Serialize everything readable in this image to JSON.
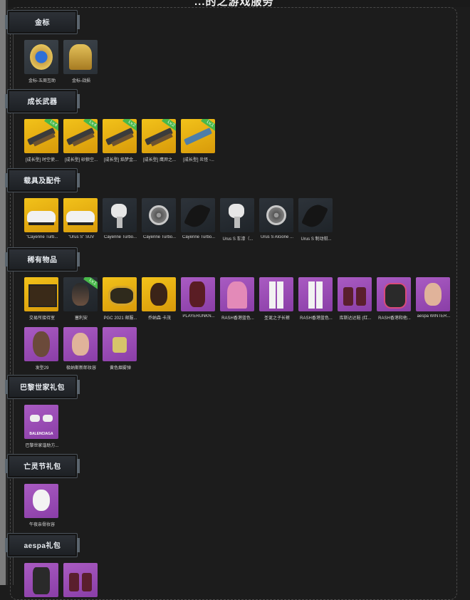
{
  "page": {
    "title": "...的之游戏服务"
  },
  "sections": [
    {
      "id": "gold-badge",
      "title": "金标",
      "items": [
        {
          "label": "金标-五周互助",
          "bg": "gray",
          "icon": "gold-emblem-icon",
          "badge": ""
        },
        {
          "label": "金标-战损",
          "bg": "gray",
          "icon": "gold-soldier-icon",
          "badge": ""
        }
      ]
    },
    {
      "id": "growth-weapons",
      "title": "成长武器",
      "items": [
        {
          "label": "[成长型] 时空使...",
          "bg": "yellow",
          "icon": "rifle-icon",
          "badge": "Lv.4"
        },
        {
          "label": "[成长型] 砂狼空...",
          "bg": "yellow",
          "icon": "rifle-icon",
          "badge": "Lv.4"
        },
        {
          "label": "[成长型] 焰梦金...",
          "bg": "yellow",
          "icon": "rifle-icon",
          "badge": "Lv.2"
        },
        {
          "label": "[成长型] 鹰羿之...",
          "bg": "yellow",
          "icon": "rifle-icon",
          "badge": "Lv.2"
        },
        {
          "label": "[成长型] 炎怪 -...",
          "bg": "yellow",
          "icon": "smg-icon",
          "badge": "Lv.1"
        }
      ]
    },
    {
      "id": "vehicles",
      "title": "载具及配件",
      "items": [
        {
          "label": "\"Cayenne Turb...",
          "bg": "yellow",
          "icon": "car-icon",
          "badge": ""
        },
        {
          "label": "\"Urus S\" SUV",
          "bg": "yellow",
          "icon": "car-icon",
          "badge": ""
        },
        {
          "label": "Cayenne Turbo...",
          "bg": "dark",
          "icon": "paint-gun-icon",
          "badge": ""
        },
        {
          "label": "Cayenne Turbo...",
          "bg": "dark",
          "icon": "wheel-icon",
          "badge": ""
        },
        {
          "label": "Cayenne Turbo...",
          "bg": "dark",
          "icon": "blade-icon",
          "badge": ""
        },
        {
          "label": "Urus S 车漆（...",
          "bg": "dark",
          "icon": "paint-gun-icon",
          "badge": ""
        },
        {
          "label": "Urus S Alcione ...",
          "bg": "dark",
          "icon": "wheel-icon",
          "badge": ""
        },
        {
          "label": "Urus S 制动钳...",
          "bg": "dark",
          "icon": "blade-icon",
          "badge": ""
        }
      ]
    },
    {
      "id": "rare-items",
      "title": "稀有物品",
      "items": [
        {
          "label": "交易所接待室",
          "bg": "yellow",
          "icon": "room-icon",
          "badge": ""
        },
        {
          "label": "塞利安",
          "bg": "dark",
          "icon": "character-icon",
          "badge": "Lv.1"
        },
        {
          "label": "PGC 2021 邮服...",
          "bg": "yellow",
          "icon": "gold-mask-icon",
          "badge": ""
        },
        {
          "label": "乔纳森·卡茂",
          "bg": "yellow",
          "icon": "face-icon",
          "badge": ""
        },
        {
          "label": "PLAYERUNKN...",
          "bg": "purple",
          "icon": "scarf-icon",
          "badge": ""
        },
        {
          "label": "RASH香港蓝色...",
          "bg": "purple",
          "icon": "hoodie-icon",
          "badge": ""
        },
        {
          "label": "圣诞之子长裤",
          "bg": "purple",
          "icon": "pants-icon",
          "badge": ""
        },
        {
          "label": "RASH香港蓝色...",
          "bg": "purple",
          "icon": "pants-icon",
          "badge": ""
        },
        {
          "label": "库斯达达鞋 (红...",
          "bg": "purple",
          "icon": "boots-icon",
          "badge": ""
        },
        {
          "label": "RASH香港和他...",
          "bg": "purple",
          "icon": "gloves-icon",
          "badge": ""
        },
        {
          "label": "aespa WINTER...",
          "bg": "purple",
          "icon": "face-icon",
          "badge": ""
        },
        {
          "label": "发型29",
          "bg": "purple",
          "icon": "hair-icon",
          "badge": ""
        },
        {
          "label": "极纳斯新郎妆容",
          "bg": "purple",
          "icon": "face-icon",
          "badge": ""
        },
        {
          "label": "黄色烟雾弹",
          "bg": "purple",
          "icon": "smoke-grenade-icon",
          "badge": ""
        }
      ]
    },
    {
      "id": "balenciaga",
      "title": "巴黎世家礼包",
      "items": [
        {
          "label": "巴黎世家谐助方...",
          "bg": "purple",
          "icon": "sunglasses-icon",
          "badge": "",
          "overlay": "BALENCIAGA"
        }
      ]
    },
    {
      "id": "dead-festival",
      "title": "亡灵节礼包",
      "items": [
        {
          "label": "午夜亲骨妆容",
          "bg": "purple",
          "icon": "skull-face-icon",
          "badge": ""
        }
      ]
    },
    {
      "id": "aespa",
      "title": "aespa礼包",
      "items": [
        {
          "label": "",
          "bg": "purple",
          "icon": "outfit-icon",
          "badge": ""
        },
        {
          "label": "",
          "bg": "purple",
          "icon": "boots-icon",
          "badge": ""
        }
      ]
    }
  ]
}
